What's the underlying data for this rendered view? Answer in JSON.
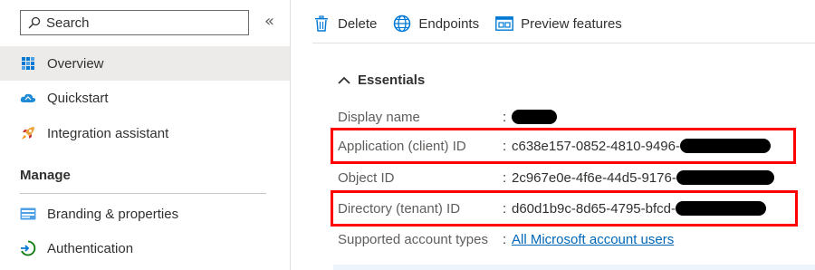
{
  "sidebar": {
    "search_placeholder": "Search",
    "collapse_glyph": "«",
    "items": [
      {
        "label": "Overview",
        "icon": "overview-grid-icon"
      },
      {
        "label": "Quickstart",
        "icon": "cloud-icon"
      },
      {
        "label": "Integration assistant",
        "icon": "rocket-icon"
      }
    ],
    "section_title": "Manage",
    "manage_items": [
      {
        "label": "Branding & properties",
        "icon": "branding-icon"
      },
      {
        "label": "Authentication",
        "icon": "authentication-icon"
      }
    ]
  },
  "toolbar": {
    "delete_label": "Delete",
    "endpoints_label": "Endpoints",
    "preview_label": "Preview features"
  },
  "essentials": {
    "header": "Essentials",
    "rows": [
      {
        "label": "Display name",
        "value": ""
      },
      {
        "label": "Application (client) ID",
        "value": "c638e157-0852-4810-9496-"
      },
      {
        "label": "Object ID",
        "value": "2c967e0e-4f6e-44d5-9176-"
      },
      {
        "label": "Directory (tenant) ID",
        "value": "d60d1b9c-8d65-4795-bfcd-"
      },
      {
        "label": "Supported account types",
        "value": "All Microsoft account users"
      }
    ],
    "colon": ":"
  },
  "colors": {
    "accent_link": "#0067b8",
    "highlight": "#ff0000",
    "active_bg": "#edebe9"
  }
}
